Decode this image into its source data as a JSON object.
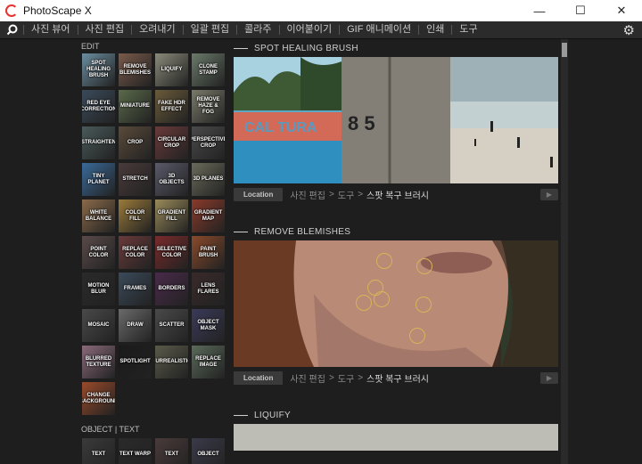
{
  "window": {
    "title": "PhotoScape X"
  },
  "titlebar_buttons": {
    "minimize": "—",
    "maximize": "☐",
    "close": "✕"
  },
  "nav": {
    "items": [
      "사진 뷰어",
      "사진 편집",
      "오려내기",
      "일괄 편집",
      "콜라주",
      "이어붙이기",
      "GIF 애니메이션",
      "인쇄",
      "도구"
    ]
  },
  "left_panel": {
    "edit_label": "EDIT",
    "edit_tiles": [
      {
        "label": "SPOT HEALING BRUSH",
        "color": "#6b8ea0"
      },
      {
        "label": "REMOVE BLEMISHES",
        "color": "#7a5a4a"
      },
      {
        "label": "LIQUIFY",
        "color": "#8a8a7a"
      },
      {
        "label": "CLONE STAMP",
        "color": "#6a7a6a"
      },
      {
        "label": "RED EYE CORRECTION",
        "color": "#3a4a5a"
      },
      {
        "label": "MINIATURE",
        "color": "#5a6a4a"
      },
      {
        "label": "FAKE HDR EFFECT",
        "color": "#6a5a3a"
      },
      {
        "label": "REMOVE HAZE & FOG",
        "color": "#7a7a6a"
      },
      {
        "label": "STRAIGHTEN",
        "color": "#4a5a5a"
      },
      {
        "label": "CROP",
        "color": "#5a4a3a"
      },
      {
        "label": "CIRCULAR CROP",
        "color": "#6a3a3a"
      },
      {
        "label": "PERSPECTIVE CROP",
        "color": "#4a4a4a"
      },
      {
        "label": "TINY PLANET",
        "color": "#3a6a9a"
      },
      {
        "label": "STRETCH",
        "color": "#4a3a3a"
      },
      {
        "label": "3D OBJECTS",
        "color": "#5a5a6a"
      },
      {
        "label": "3D PLANES",
        "color": "#6a6a5a"
      },
      {
        "label": "WHITE BALANCE",
        "color": "#8a6a4a"
      },
      {
        "label": "COLOR FILL",
        "color": "#9a7a3a"
      },
      {
        "label": "GRADIENT FILL",
        "color": "#9a8a5a"
      },
      {
        "label": "GRADIENT MAP",
        "color": "#8a3a2a"
      },
      {
        "label": "POINT COLOR",
        "color": "#5a4a4a"
      },
      {
        "label": "REPLACE COLOR",
        "color": "#6a3a3a"
      },
      {
        "label": "SELECTIVE COLOR",
        "color": "#7a2a2a"
      },
      {
        "label": "PAINT BRUSH",
        "color": "#8a4a2a"
      },
      {
        "label": "MOTION BLUR",
        "color": "#2a2a2a"
      },
      {
        "label": "FRAMES",
        "color": "#3a4a5a"
      },
      {
        "label": "BORDERS",
        "color": "#4a2a4a"
      },
      {
        "label": "LENS FLARES",
        "color": "#3a2a2a"
      },
      {
        "label": "MOSAIC",
        "color": "#4a4a4a"
      },
      {
        "label": "DRAW",
        "color": "#6a6a6a"
      },
      {
        "label": "SCATTER",
        "color": "#4a4a4a"
      },
      {
        "label": "OBJECT MASK",
        "color": "#3a3a5a"
      },
      {
        "label": "BLURRED TEXTURE",
        "color": "#8a6a7a"
      },
      {
        "label": "SPOTLIGHT",
        "color": "#1a1a1a"
      },
      {
        "label": "SURREALISTIC",
        "color": "#5a5a4a"
      },
      {
        "label": "REPLACE IMAGE",
        "color": "#5a6a5a"
      },
      {
        "label": "CHANGE BACKGROUND",
        "color": "#9a4a2a"
      }
    ],
    "object_label": "OBJECT | TEXT",
    "object_tiles": [
      {
        "label": "TEXT",
        "color": "#3a3a3a"
      },
      {
        "label": "TEXT WARP",
        "color": "#2a2a2a"
      },
      {
        "label": "TEXT",
        "color": "#4a3a3a"
      },
      {
        "label": "OBJECT",
        "color": "#3a3a4a"
      }
    ]
  },
  "sections": [
    {
      "title": "SPOT HEALING BRUSH",
      "location_label": "Location",
      "crumb1": "사진 편집",
      "crumb2": "도구",
      "crumb3": "스팟 복구 브러시",
      "sep": ">"
    },
    {
      "title": "REMOVE BLEMISHES",
      "location_label": "Location",
      "crumb1": "사진 편집",
      "crumb2": "도구",
      "crumb3": "스팟 복구 브러시",
      "sep": ">"
    },
    {
      "title": "LIQUIFY"
    }
  ],
  "image_text": {
    "sign": "CAL TURA",
    "numbers": "8  5"
  }
}
